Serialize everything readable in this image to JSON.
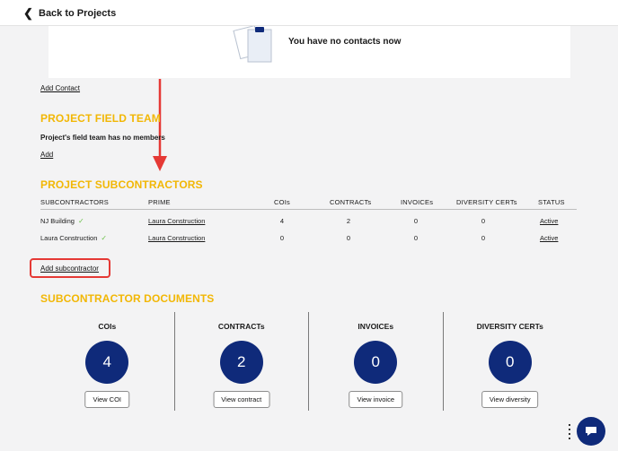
{
  "header": {
    "back_label": "Back to Projects"
  },
  "contacts": {
    "empty_text": "You have no contacts now",
    "add_label": "Add Contact"
  },
  "field_team": {
    "title": "PROJECT FIELD TEAM",
    "empty_text": "Project's field team has no members",
    "add_label": "Add"
  },
  "subcontractors": {
    "title": "PROJECT SUBCONTRACTORS",
    "columns": [
      "SUBCONTRACTORS",
      "PRIME",
      "COIs",
      "CONTRACTs",
      "INVOICEs",
      "DIVERSITY CERTs",
      "STATUS"
    ],
    "rows": [
      {
        "name": "NJ Building",
        "prime": "Laura Construction",
        "cois": "4",
        "contracts": "2",
        "invoices": "0",
        "diversity": "0",
        "status": "Active"
      },
      {
        "name": "Laura Construction",
        "prime": "Laura Construction",
        "cois": "0",
        "contracts": "0",
        "invoices": "0",
        "diversity": "0",
        "status": "Active"
      }
    ],
    "add_label": "Add subcontractor"
  },
  "documents": {
    "title": "SUBCONTRACTOR DOCUMENTS",
    "cards": [
      {
        "label": "COIs",
        "count": "4",
        "button": "View COI"
      },
      {
        "label": "CONTRACTs",
        "count": "2",
        "button": "View contract"
      },
      {
        "label": "INVOICEs",
        "count": "0",
        "button": "View invoice"
      },
      {
        "label": "DIVERSITY CERTs",
        "count": "0",
        "button": "View diversity"
      }
    ]
  },
  "colors": {
    "accent": "#f2b705",
    "brand": "#0f2a7a",
    "annotation": "#e53935",
    "check": "#6cc04a"
  },
  "icons": {
    "back": "chevron-left-icon",
    "check": "checkmark-icon",
    "chat": "chat-bubble-icon"
  }
}
